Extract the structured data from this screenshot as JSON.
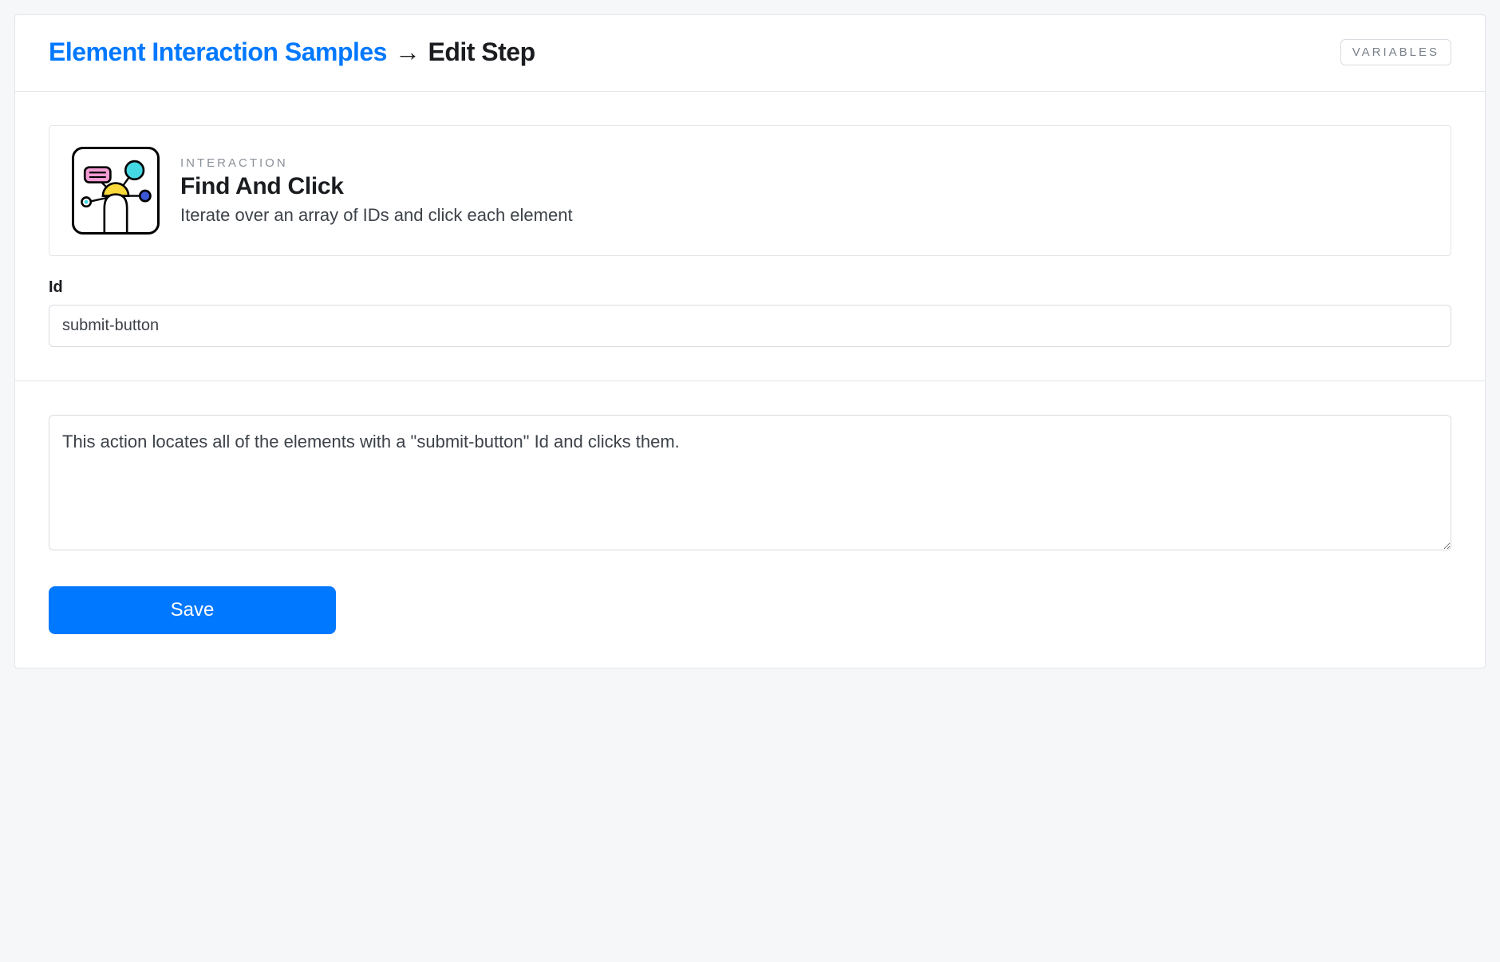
{
  "header": {
    "breadcrumb_link": "Element Interaction Samples",
    "breadcrumb_arrow": "→",
    "breadcrumb_current": "Edit Step",
    "variables_button": "VARIABLES"
  },
  "card": {
    "overline": "INTERACTION",
    "title": "Find And Click",
    "description": "Iterate over an array of IDs and click each element",
    "icon": "interaction-nodes-icon"
  },
  "fields": {
    "id": {
      "label": "Id",
      "value": "submit-button"
    },
    "description": {
      "value": "This action locates all of the elements with a \"submit-button\" Id and clicks them."
    }
  },
  "actions": {
    "save_label": "Save"
  },
  "colors": {
    "accent": "#0078ff",
    "pink": "#f49bd3",
    "cyan": "#44d8e2",
    "yellow": "#f9d93b",
    "blue": "#3b57d6"
  }
}
